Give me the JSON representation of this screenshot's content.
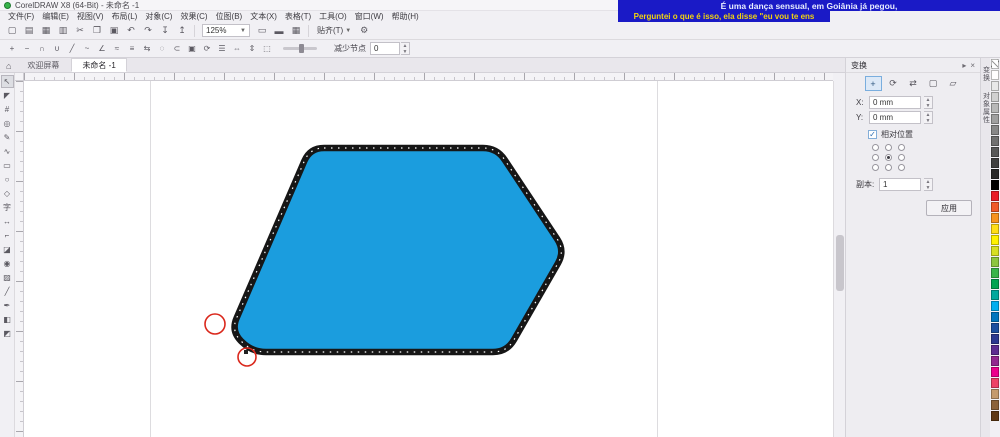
{
  "window": {
    "title": "CorelDRAW X8 (64-Bit) - 未命名 -1"
  },
  "subtitle_overlay": {
    "line1": "É uma dança sensual, em Goiânia já pegou,",
    "line2": "Perguntei o que é isso, ela disse \"eu vou te ens"
  },
  "menubar": {
    "items": [
      "文件(F)",
      "编辑(E)",
      "视图(V)",
      "布局(L)",
      "对象(C)",
      "效果(C)",
      "位图(B)",
      "文本(X)",
      "表格(T)",
      "工具(O)",
      "窗口(W)",
      "帮助(H)"
    ]
  },
  "standard_toolbar": {
    "icons": [
      {
        "name": "new-document-icon",
        "glyph": "▢"
      },
      {
        "name": "open-icon",
        "glyph": "▤"
      },
      {
        "name": "save-icon",
        "glyph": "▦"
      },
      {
        "name": "print-icon",
        "glyph": "▥"
      },
      {
        "name": "cut-icon",
        "glyph": "✂"
      },
      {
        "name": "copy-icon",
        "glyph": "❐"
      },
      {
        "name": "paste-icon",
        "glyph": "▣"
      },
      {
        "name": "undo-icon",
        "glyph": "↶"
      },
      {
        "name": "redo-icon",
        "glyph": "↷"
      },
      {
        "name": "import-icon",
        "glyph": "↧"
      },
      {
        "name": "export-icon",
        "glyph": "↥"
      }
    ],
    "zoom_value": "125%",
    "view_icons": [
      {
        "name": "fullscreen-preview-icon",
        "glyph": "▭"
      },
      {
        "name": "show-rulers-icon",
        "glyph": "▬"
      },
      {
        "name": "grid-icon",
        "glyph": "▦"
      }
    ],
    "snap_label": "贴齐(T)",
    "gear_glyph": "⚙"
  },
  "property_bar": {
    "icons": [
      {
        "name": "add-node-icon",
        "glyph": "+"
      },
      {
        "name": "delete-node-icon",
        "glyph": "−"
      },
      {
        "name": "join-nodes-icon",
        "glyph": "∩"
      },
      {
        "name": "break-curve-icon",
        "glyph": "∪"
      },
      {
        "name": "convert-to-line-icon",
        "glyph": "╱"
      },
      {
        "name": "convert-to-curve-icon",
        "glyph": "~"
      },
      {
        "name": "cusp-node-icon",
        "glyph": "∠"
      },
      {
        "name": "smooth-node-icon",
        "glyph": "≈"
      },
      {
        "name": "symmetric-node-icon",
        "glyph": "≡"
      },
      {
        "name": "reverse-direction-icon",
        "glyph": "⇆"
      },
      {
        "name": "close-curve-icon",
        "glyph": "◌"
      },
      {
        "name": "extract-subpath-icon",
        "glyph": "⊂"
      },
      {
        "name": "stretch-nodes-icon",
        "glyph": "▣"
      },
      {
        "name": "rotate-nodes-icon",
        "glyph": "⟳"
      },
      {
        "name": "align-nodes-icon",
        "glyph": "☰"
      },
      {
        "name": "reflect-horizontal-icon",
        "glyph": "⇔"
      },
      {
        "name": "reflect-vertical-icon",
        "glyph": "⇕"
      },
      {
        "name": "select-all-nodes-icon",
        "glyph": "⬚"
      }
    ],
    "reduce_nodes_label": "减少节点",
    "reduce_nodes_value": "0"
  },
  "document_tabs": {
    "home_glyph": "⌂",
    "tabs": [
      {
        "label": "欢迎屏幕",
        "active": false
      },
      {
        "label": "未命名 -1",
        "active": true
      }
    ]
  },
  "toolbox": {
    "tools": [
      {
        "name": "pick-tool",
        "glyph": "↖",
        "active": true
      },
      {
        "name": "shape-tool",
        "glyph": "◤"
      },
      {
        "name": "crop-tool",
        "glyph": "#"
      },
      {
        "name": "zoom-tool",
        "glyph": "◎"
      },
      {
        "name": "freehand-tool",
        "glyph": "✎"
      },
      {
        "name": "artistic-media-tool",
        "glyph": "∿"
      },
      {
        "name": "rectangle-tool",
        "glyph": "▭"
      },
      {
        "name": "ellipse-tool",
        "glyph": "○"
      },
      {
        "name": "polygon-tool",
        "glyph": "◇"
      },
      {
        "name": "text-tool",
        "glyph": "字"
      },
      {
        "name": "dimension-tool",
        "glyph": "↔"
      },
      {
        "name": "connector-tool",
        "glyph": "⌐"
      },
      {
        "name": "drop-shadow-tool",
        "glyph": "◪"
      },
      {
        "name": "contour-tool",
        "glyph": "◉"
      },
      {
        "name": "transparency-tool",
        "glyph": "▨"
      },
      {
        "name": "color-eyedropper-tool",
        "glyph": "╱"
      },
      {
        "name": "outline-pen-tool",
        "glyph": "✒"
      },
      {
        "name": "fill-tool",
        "glyph": "◧"
      },
      {
        "name": "interactive-fill-tool",
        "glyph": "◩"
      }
    ]
  },
  "canvas": {
    "shape": {
      "fill": "#1b9dde",
      "stroke": "#161616"
    },
    "annotation_color": "#da281c"
  },
  "docker": {
    "title": "变换",
    "header_icons": {
      "expand": "▸",
      "close": "×"
    },
    "mode_icons": [
      {
        "name": "transform-position-icon",
        "glyph": "+",
        "active": true
      },
      {
        "name": "transform-rotate-icon",
        "glyph": "⟳"
      },
      {
        "name": "transform-scale-mirror-icon",
        "glyph": "⇄"
      },
      {
        "name": "transform-size-icon",
        "glyph": "▢"
      },
      {
        "name": "transform-skew-icon",
        "glyph": "▱"
      }
    ],
    "x_label": "X:",
    "x_value": "0 mm",
    "y_label": "Y:",
    "y_value": "0 mm",
    "relative_label": "相对位置",
    "checkbox_glyph": "✓",
    "anchors": [
      {
        "active": false
      },
      {
        "active": false
      },
      {
        "active": false
      },
      {
        "active": false
      },
      {
        "active": true
      },
      {
        "active": false
      },
      {
        "active": false
      },
      {
        "active": false
      },
      {
        "active": false
      }
    ],
    "copies_label": "副本:",
    "copies_value": "1",
    "apply_label": "应用"
  },
  "side_tabs": {
    "items": [
      "变换",
      "对象属性"
    ]
  },
  "palette": {
    "colors": [
      "#FFFFFF",
      "#E8E8E8",
      "#D0D0D0",
      "#B8B8B8",
      "#A0A0A0",
      "#888888",
      "#707070",
      "#585858",
      "#404040",
      "#282828",
      "#000000",
      "#EA1B25",
      "#F05A28",
      "#F7941E",
      "#FFDE17",
      "#FFF200",
      "#D7DF23",
      "#8DC63F",
      "#39B54A",
      "#00A551",
      "#00A99E",
      "#00AEEF",
      "#0076BE",
      "#1B4FA0",
      "#2B3990",
      "#5C2D91",
      "#92278F",
      "#EC008C",
      "#EE4266",
      "#C49A6C",
      "#8C6239",
      "#603913"
    ]
  }
}
